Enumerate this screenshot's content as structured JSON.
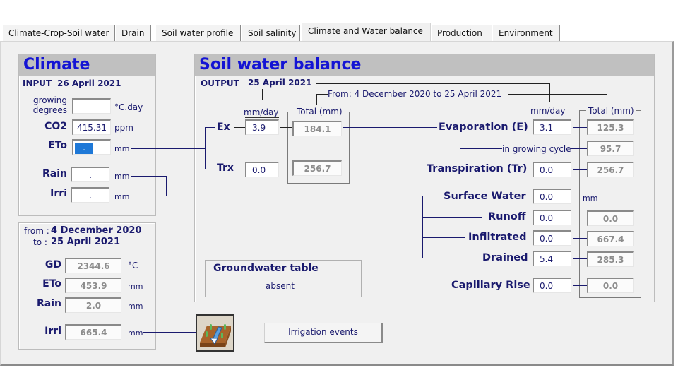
{
  "tabs": [
    {
      "label": "Climate-Crop-Soil water",
      "active": false
    },
    {
      "label": "Drain",
      "active": false
    },
    {
      "label": "Soil water profile",
      "active": false
    },
    {
      "label": "Soil salinity",
      "active": false
    },
    {
      "label": "Climate and Water balance",
      "active": true
    },
    {
      "label": "Production",
      "active": false
    },
    {
      "label": "Environment",
      "active": false
    }
  ],
  "climate": {
    "title": "Climate",
    "input_label": "INPUT",
    "input_date": "26 April 2021",
    "growing_degrees": {
      "label_line1": "growing",
      "label_line2": "degrees",
      "value": "",
      "unit": "°C.day"
    },
    "co2": {
      "label": "CO2",
      "value": "415.31",
      "unit": "ppm"
    },
    "eto": {
      "label": "ETo",
      "value": ".",
      "unit": "mm"
    },
    "rain": {
      "label": "Rain",
      "value": ".",
      "unit": "mm"
    },
    "irri": {
      "label": "Irri",
      "value": ".",
      "unit": "mm"
    },
    "period": {
      "from_label": "from :",
      "from_date": "4 December 2020",
      "to_label": "to :",
      "to_date": "25 April 2021",
      "gd": {
        "label": "GD",
        "value": "2344.6",
        "unit": "°C"
      },
      "eto": {
        "label": "ETo",
        "value": "453.9",
        "unit": "mm"
      },
      "rain": {
        "label": "Rain",
        "value": "2.0",
        "unit": "mm"
      },
      "irri": {
        "label": "Irri",
        "value": "665.4",
        "unit": "mm"
      }
    }
  },
  "swb": {
    "title": "Soil water balance",
    "output_label": "OUTPUT",
    "output_date": "25 April 2021",
    "period_text": "From: 4 December 2020  to 25 April 2021",
    "mmday_label": "mm/day",
    "total_label": "Total (mm)",
    "ex": {
      "label": "Ex",
      "daily": "3.9",
      "total": "184.1"
    },
    "trx": {
      "label": "Trx",
      "daily": "0.0",
      "total": "256.7"
    },
    "evaporation": {
      "label": "Evaporation (E)",
      "daily": "3.1",
      "total": "125.3"
    },
    "growing_cycle": {
      "label": "in growing cycle",
      "total": "95.7"
    },
    "transpiration": {
      "label": "Transpiration (Tr)",
      "daily": "0.0",
      "total": "256.7"
    },
    "surface_water": {
      "label": "Surface Water",
      "daily": "0.0",
      "unit": "mm"
    },
    "runoff": {
      "label": "Runoff",
      "daily": "0.0",
      "total": "0.0"
    },
    "infiltrated": {
      "label": "Infiltrated",
      "daily": "0.0",
      "total": "667.4"
    },
    "drained": {
      "label": "Drained",
      "daily": "5.4",
      "total": "285.3"
    },
    "capillary_rise": {
      "label": "Capillary Rise",
      "daily": "0.0",
      "total": "0.0"
    },
    "groundwater": {
      "title": "Groundwater table",
      "status": "absent"
    }
  },
  "irrigation": {
    "icon": "irrigation-icon",
    "button_label": "Irrigation events"
  }
}
